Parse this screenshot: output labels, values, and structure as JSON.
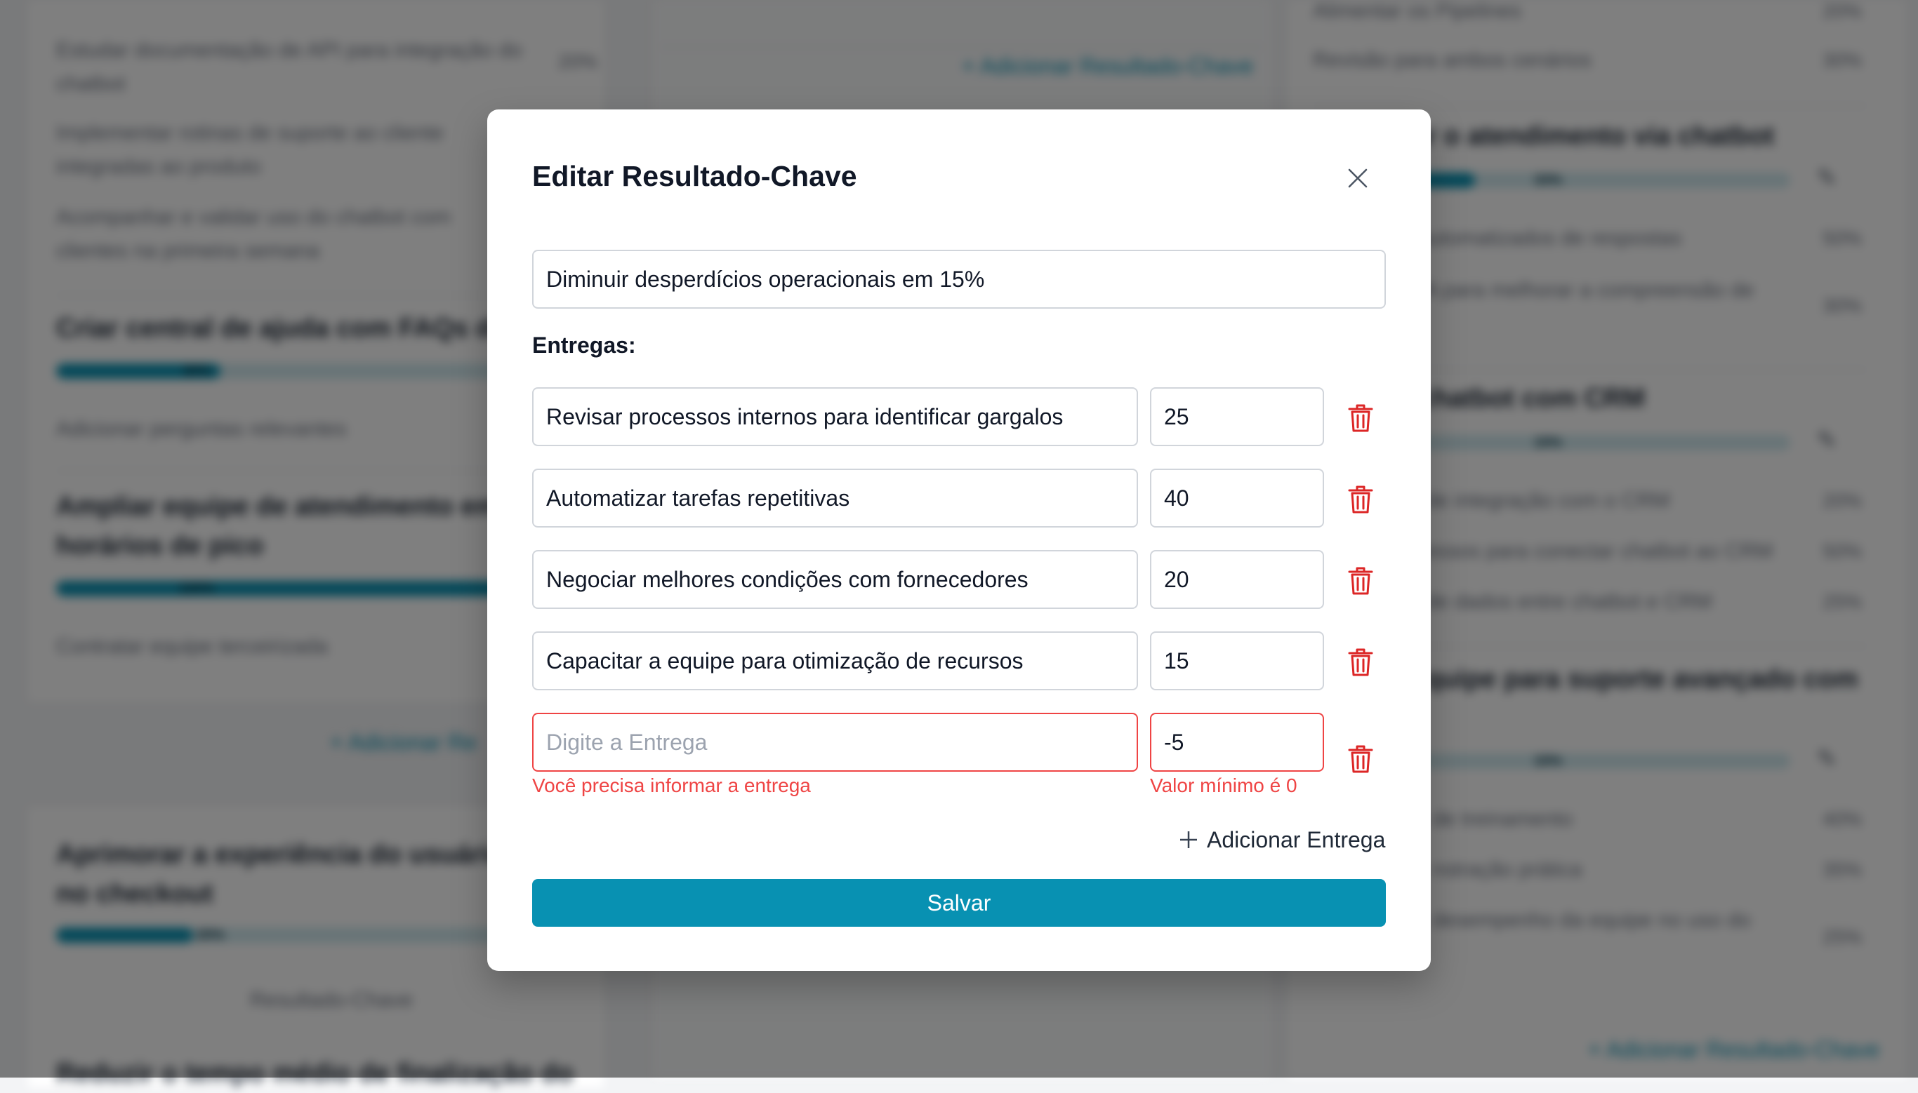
{
  "modal": {
    "title": "Editar Resultado-Chave",
    "key_result_value": "Diminuir desperdícios operacionais em 15%",
    "deliveries_label": "Entregas:",
    "deliveries": [
      {
        "text": "Revisar processos internos para identificar gargalos",
        "value": "25",
        "placeholder": "Digite a Entrega"
      },
      {
        "text": "Automatizar tarefas repetitivas",
        "value": "40",
        "placeholder": "Digite a Entrega"
      },
      {
        "text": "Negociar melhores condições com fornecedores",
        "value": "20",
        "placeholder": "Digite a Entrega"
      },
      {
        "text": "Capacitar a equipe para otimização de recursos",
        "value": "15",
        "placeholder": "Digite a Entrega"
      },
      {
        "text": "",
        "value": "-5",
        "placeholder": "Digite a Entrega",
        "text_error": "Você precisa informar a entrega",
        "value_error": "Valor mínimo é 0"
      }
    ],
    "add_delivery_label": "Adicionar Entrega",
    "save_label": "Salvar",
    "icons": {
      "close": "close-icon",
      "trash": "trash-icon",
      "add": "plus-icon"
    }
  },
  "background": {
    "left_column": {
      "items": [
        {
          "text": "Estudar documentação de API para integração do chatbot",
          "pct": "20%"
        },
        {
          "text": "Implementar rotinas de suporte ao cliente integradas ao produto"
        },
        {
          "text": "Acompanhar e validar uso do chatbot com clientes na primeira semana"
        }
      ],
      "objective_1": {
        "title": "Criar central de ajuda com FAQs de",
        "progress": 30,
        "progress_label": "30%",
        "item": "Adicionar perguntas relevantes"
      },
      "objective_2": {
        "title": "Ampliar equipe de atendimento em horários de pico",
        "progress": 100,
        "progress_label": "100%",
        "item": "Contratar equipe terceirizada"
      },
      "add_link": "+ Adicionar Re",
      "objective_3": {
        "title": "Aprimorar a experiência do usuário no checkout",
        "progress": 25,
        "progress_label": "25%",
        "footer": "Resultado-Chave"
      },
      "objective_4": {
        "title": "Reduzir o tempo médio de finalização do"
      }
    },
    "middle_column": {
      "add_link": "+ Adicionar Resultado-Chave"
    },
    "right_column": {
      "top_items": [
        {
          "text": "Alimentar os Pipelines",
          "pct": "20%"
        },
        {
          "text": "Revisão para ambos cenários",
          "pct": "30%"
        }
      ],
      "objective_1": {
        "title": "ar o atendimento via chatbot",
        "progress": 33,
        "progress_label": "33%",
        "items": [
          {
            "text": "automatizados de respostas",
            "pct": "50%"
          },
          {
            "text": "IA para melhorar a compreensão de",
            "pct": "30%"
          }
        ]
      },
      "objective_2": {
        "title": "chatbot com CRM",
        "progress": 15,
        "progress_label": "15%",
        "items": [
          {
            "text": "de integração com o CRM",
            "pct": "20%"
          },
          {
            "text": "essos para conectar chatbot ao CRM",
            "pct": "50%"
          },
          {
            "text": "de dados entre chatbot e CRM",
            "pct": "25%"
          }
        ]
      },
      "objective_3": {
        "title": "quipe para suporte avançado com",
        "progress": 15,
        "progress_label": "15%",
        "items": [
          {
            "text": "de treinamento",
            "pct": "40%"
          },
          {
            "text": "nstração prática",
            "pct": "35%"
          },
          {
            "text": "desempenho da equipe no uso do",
            "pct": "25%"
          }
        ]
      },
      "add_link": "+ Adicionar Resultado-Chave"
    }
  }
}
